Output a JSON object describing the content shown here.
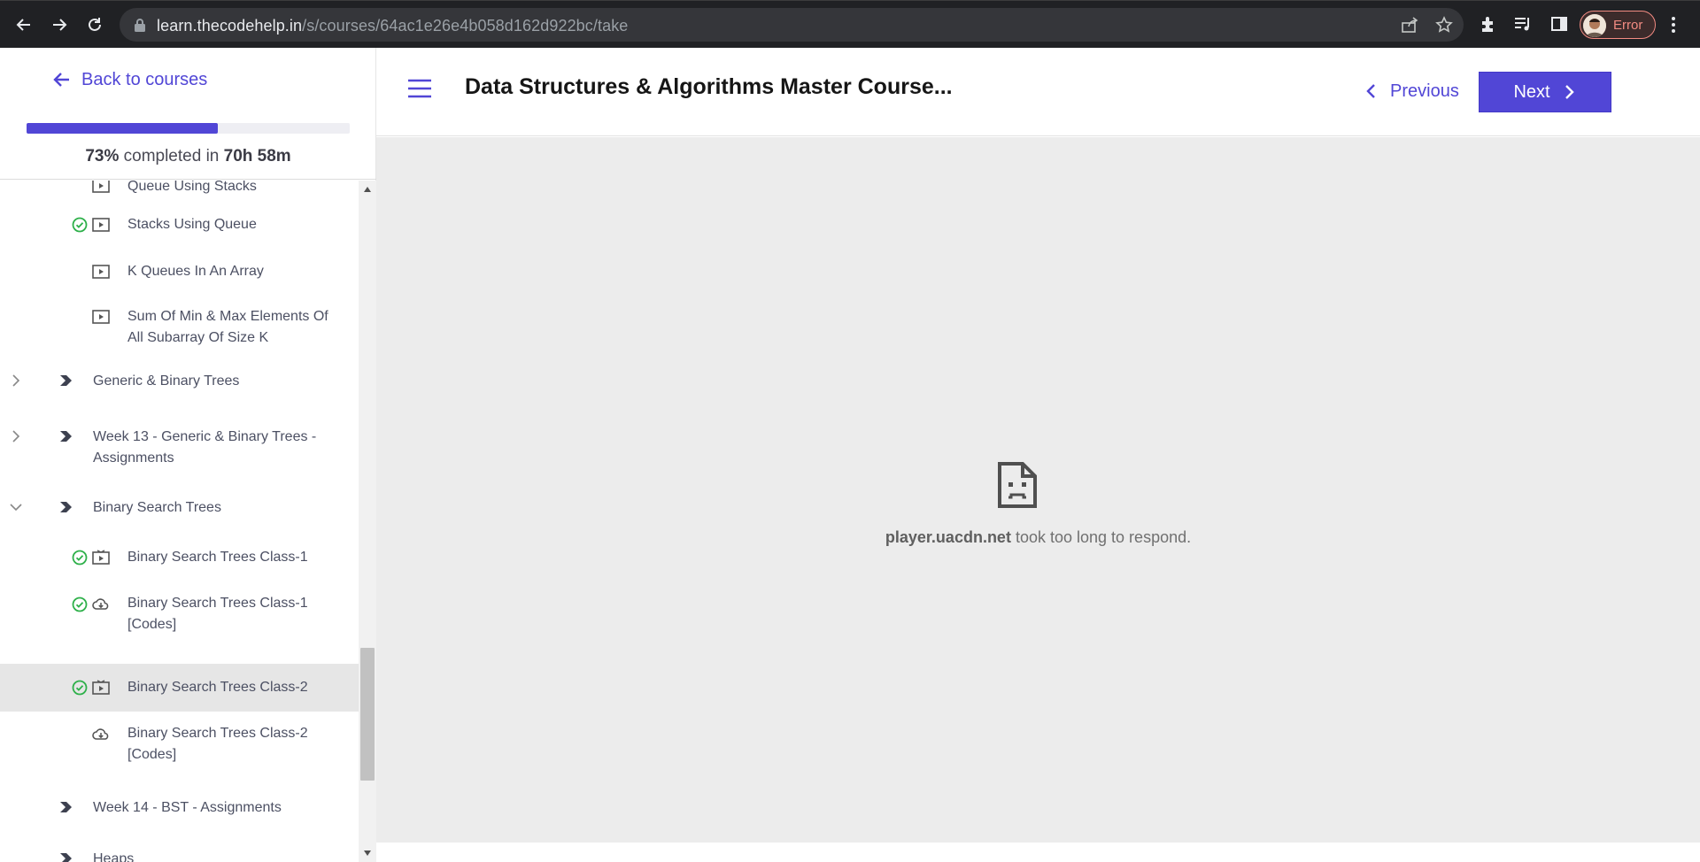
{
  "browser": {
    "url_host": "learn.thecodehelp.in",
    "url_path": "/s/courses/64ac1e26e4b058d162d922bc/take",
    "profile_label": "Error"
  },
  "sidebar": {
    "back_label": "Back to courses",
    "progress": {
      "percent_value": 73,
      "percent_text": "73%",
      "middle_text": "completed in",
      "time_text": "70h 58m"
    },
    "items": [
      {
        "label": "Queue Using Stacks"
      },
      {
        "label": "Stacks Using Queue"
      },
      {
        "label": "K Queues In An Array"
      },
      {
        "label": "Sum Of Min & Max Elements Of All Subarray Of Size K"
      },
      {
        "label": "Generic & Binary Trees"
      },
      {
        "label": "Week 13 - Generic & Binary Trees - Assignments"
      },
      {
        "label": "Binary Search Trees"
      },
      {
        "label": "Binary Search Trees Class-1"
      },
      {
        "label": "Binary Search Trees Class-1 [Codes]"
      },
      {
        "label": "Binary Search Trees Class-2"
      },
      {
        "label": "Binary Search Trees Class-2 [Codes]"
      },
      {
        "label": "Week 14 - BST - Assignments"
      },
      {
        "label": "Heaps"
      }
    ]
  },
  "topbar": {
    "title": "Data Structures & Algorithms Master Course...",
    "previous_label": "Previous",
    "next_label": "Next"
  },
  "error": {
    "host": "player.uacdn.net",
    "message": "took too long to respond."
  },
  "colors": {
    "accent": "#5146d6",
    "success": "#2eb04a"
  }
}
